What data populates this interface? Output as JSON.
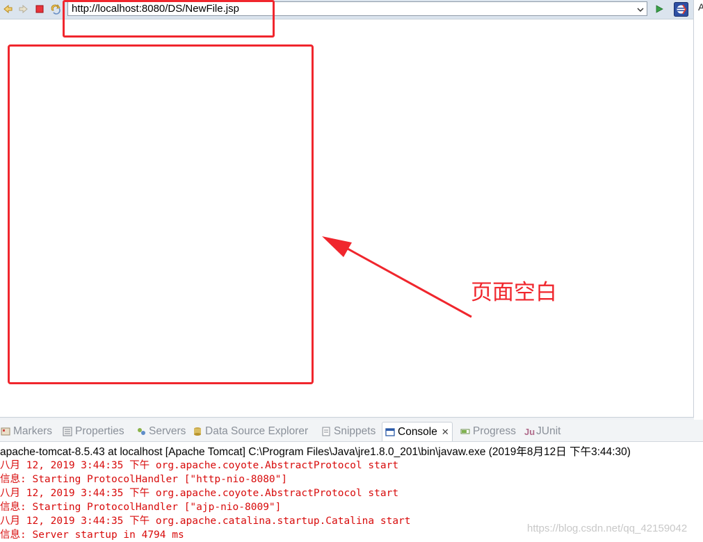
{
  "browser": {
    "url": "http://localhost:8080/DS/NewFile.jsp",
    "edge_letter": "A",
    "icons": [
      "back-icon",
      "forward-icon",
      "stop-icon",
      "refresh-icon",
      "go-icon",
      "eclipse-icon"
    ]
  },
  "annotation": {
    "caption": "页面空白",
    "color": "#f0262d"
  },
  "tabs": [
    {
      "label": "Markers",
      "icon": "markers-icon",
      "active": false
    },
    {
      "label": "Properties",
      "icon": "properties-icon",
      "active": false
    },
    {
      "label": "Servers",
      "icon": "servers-icon",
      "active": false
    },
    {
      "label": "Data Source Explorer",
      "icon": "data-source-icon",
      "active": false
    },
    {
      "label": "Snippets",
      "icon": "snippets-icon",
      "active": false
    },
    {
      "label": "Console",
      "icon": "console-icon",
      "active": true,
      "close": "✕"
    },
    {
      "label": "Progress",
      "icon": "progress-icon",
      "active": false
    },
    {
      "label": "JUnit",
      "icon": "junit-icon",
      "active": false
    }
  ],
  "console": {
    "header": "apache-tomcat-8.5.43 at localhost [Apache Tomcat] C:\\Program Files\\Java\\jre1.8.0_201\\bin\\javaw.exe (2019年8月12日 下午3:44:30)",
    "lines": [
      "八月 12, 2019 3:44:35 下午 org.apache.coyote.AbstractProtocol start",
      "信息: Starting ProtocolHandler [\"http-nio-8080\"]",
      "八月 12, 2019 3:44:35 下午 org.apache.coyote.AbstractProtocol start",
      "信息: Starting ProtocolHandler [\"ajp-nio-8009\"]",
      "八月 12, 2019 3:44:35 下午 org.apache.catalina.startup.Catalina start",
      "信息: Server startup in 4794 ms"
    ],
    "text_color": "#d80b0b"
  },
  "watermark": "https://blog.csdn.net/qq_42159042"
}
